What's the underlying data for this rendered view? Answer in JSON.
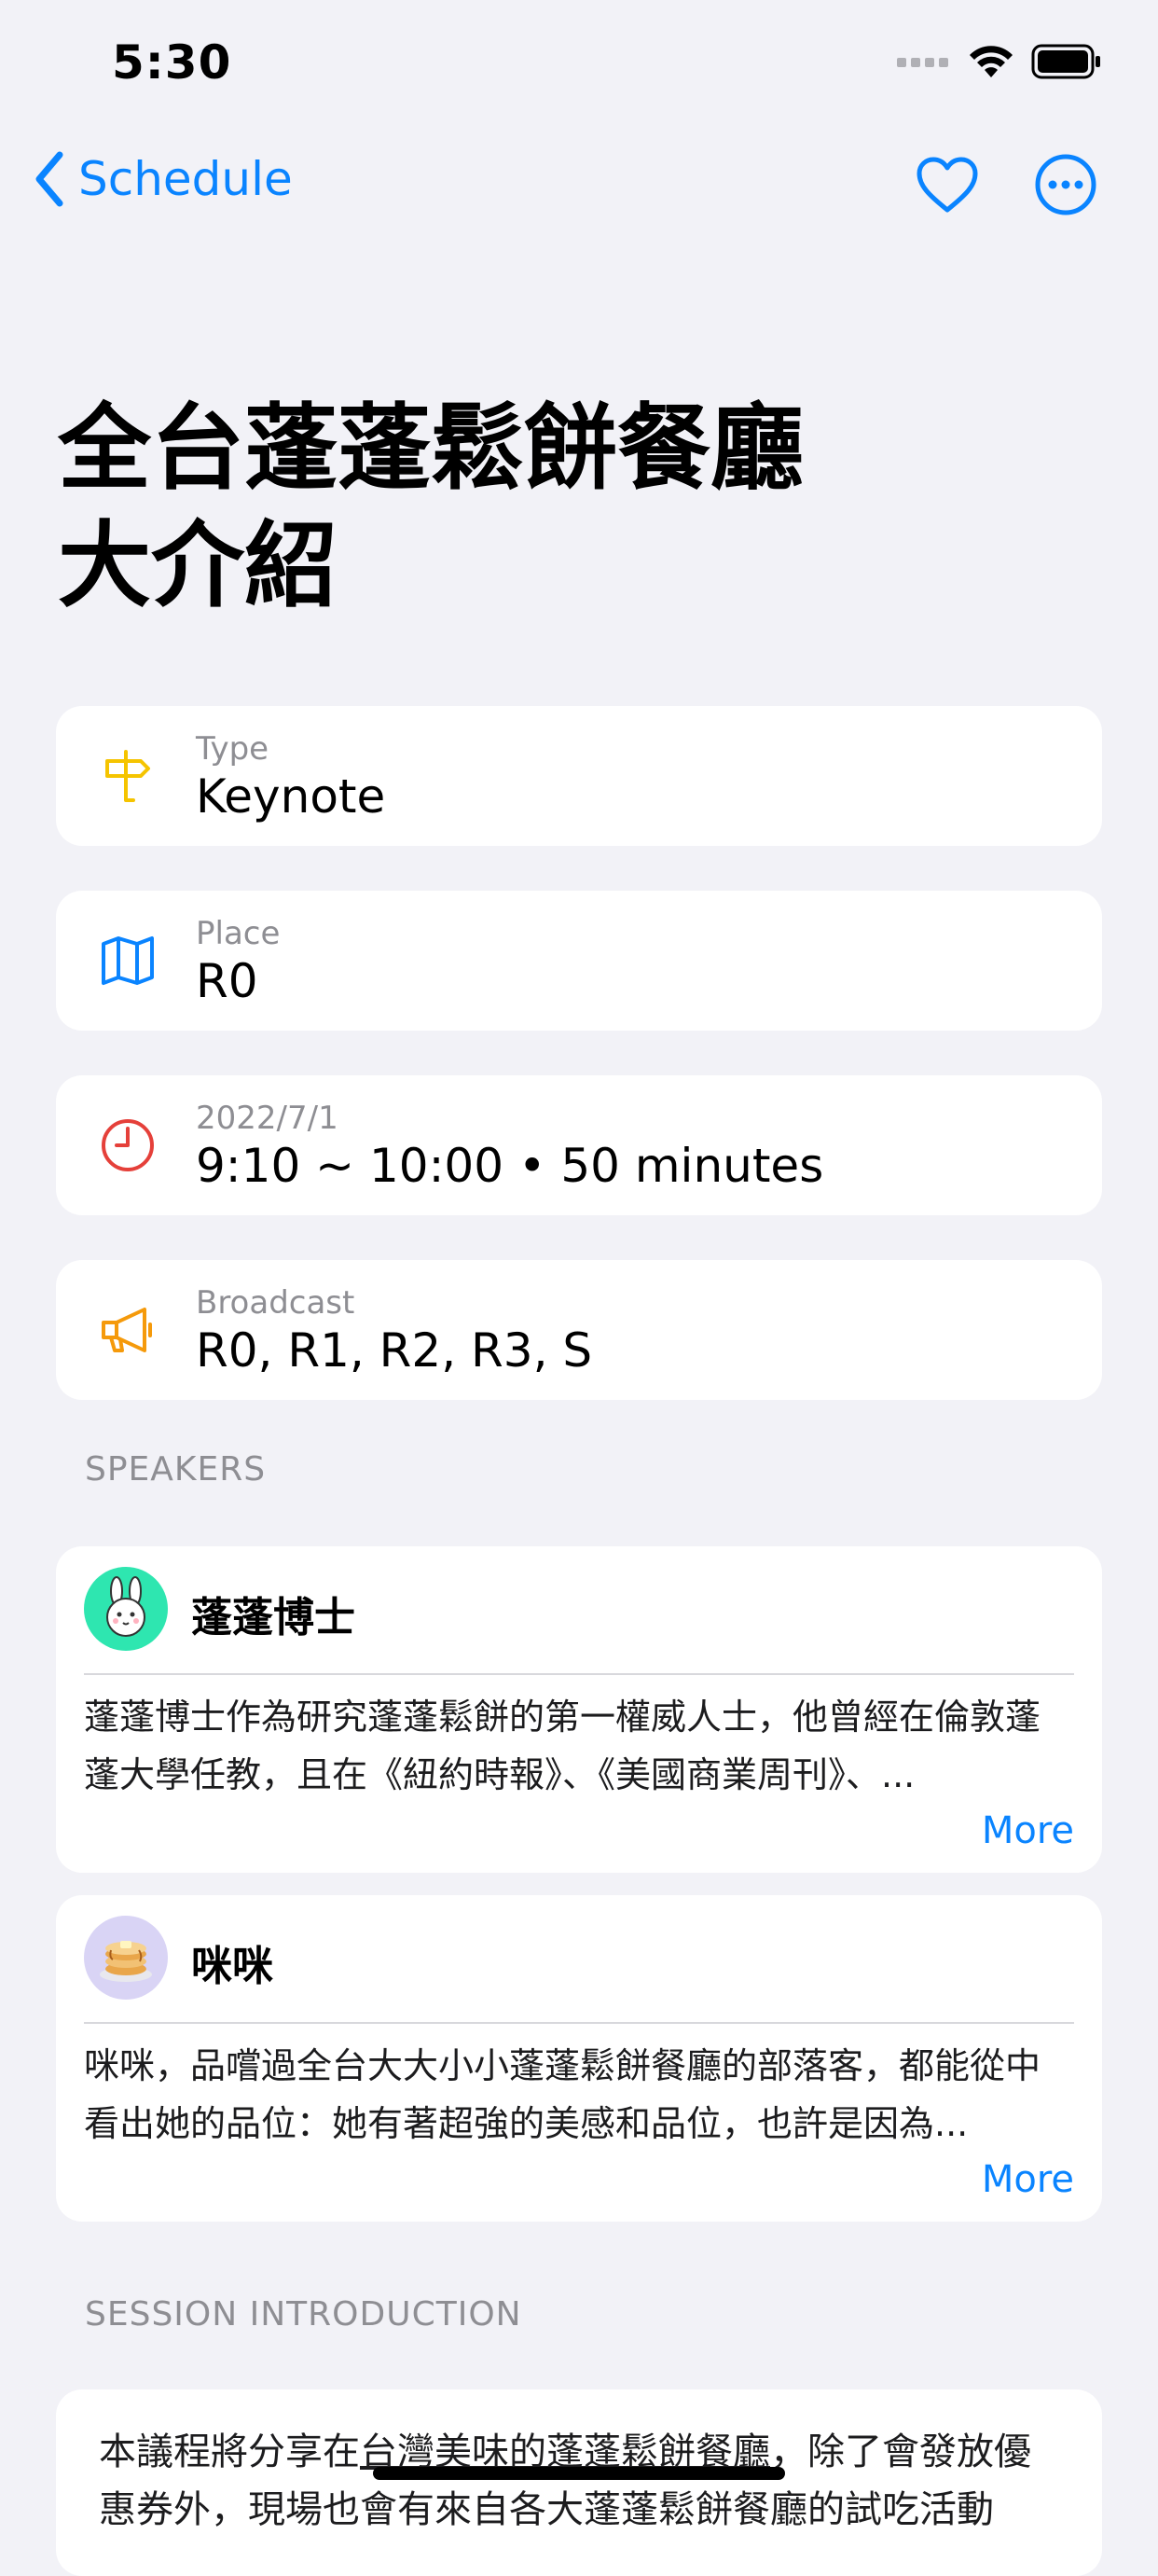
{
  "status_bar": {
    "time": "5:30"
  },
  "nav": {
    "back_label": "Schedule"
  },
  "session": {
    "title": "全台蓬蓬鬆餅餐廳\n大介紹"
  },
  "info_cards": [
    {
      "icon": "signpost-icon",
      "label": "Type",
      "value": "Keynote",
      "color": "#f5c400"
    },
    {
      "icon": "map-icon",
      "label": "Place",
      "value": "R0",
      "color": "#0a84ff"
    },
    {
      "icon": "clock-icon",
      "label": "2022/7/1",
      "value": "9:10 ~ 10:00 • 50 minutes",
      "color": "#e5403a"
    },
    {
      "icon": "megaphone-icon",
      "label": "Broadcast",
      "value": "R0, R1, R2, R3, S",
      "color": "#f59a0b"
    }
  ],
  "speakers_header": "SPEAKERS",
  "speakers": [
    {
      "name": "蓬蓬博士",
      "avatar": "rabbit-avatar",
      "bio": "蓬蓬博士作為研究蓬蓬鬆餅的第一權威人士，他曾經在倫敦蓬蓬大學任教，且在《紐約時報》、《美國商業周刊》、...",
      "more_label": "More"
    },
    {
      "name": "咪咪",
      "avatar": "pancake-avatar",
      "bio": "咪咪，品嚐過全台大大小小蓬蓬鬆餅餐廳的部落客，都能從中看出她的品位：她有著超強的美感和品位，也許是因為...",
      "more_label": "More"
    }
  ],
  "intro_header": "SESSION INTRODUCTION",
  "intro": {
    "text_before": "本議程將分享在",
    "link_text": "台灣美味的蓬蓬鬆餅餐廳",
    "text_after": "，除了會發放優惠券外，現場也會有來自各大蓬蓬鬆餅餐廳的試吃活動"
  }
}
